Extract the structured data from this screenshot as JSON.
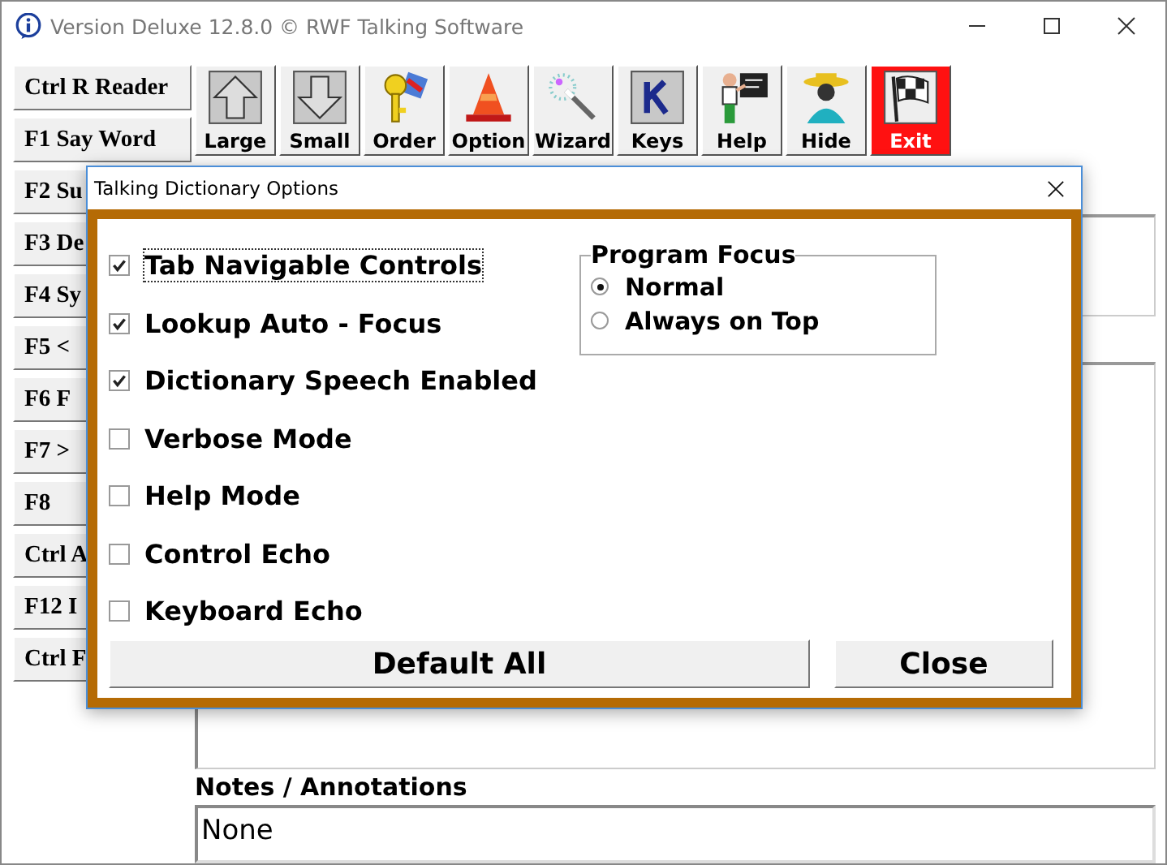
{
  "window": {
    "title": "Version Deluxe 12.8.0 © RWF Talking Software"
  },
  "sidebar": {
    "buttons": [
      "Ctrl R Reader",
      "F1 Say Word",
      "F2 Su",
      "F3 De",
      "F4 Sy",
      "F5 <",
      "F6 F",
      "F7 >",
      "F8",
      "Ctrl A",
      "F12 I",
      "Ctrl F"
    ]
  },
  "toolbar": [
    {
      "label": "Large",
      "kind": "normal"
    },
    {
      "label": "Small",
      "kind": "normal"
    },
    {
      "label": "Order",
      "kind": "normal"
    },
    {
      "label": "Option",
      "kind": "normal"
    },
    {
      "label": "Wizard",
      "kind": "normal"
    },
    {
      "label": "Keys",
      "kind": "normal"
    },
    {
      "label": "Help",
      "kind": "normal"
    },
    {
      "label": "Hide",
      "kind": "normal"
    },
    {
      "label": "Exit",
      "kind": "exit"
    }
  ],
  "notes": {
    "label": "Notes / Annotations",
    "value": "None"
  },
  "dialog": {
    "title": "Talking Dictionary Options",
    "options": [
      {
        "label": "Tab Navigable Controls",
        "checked": true,
        "focused": true
      },
      {
        "label": "Lookup Auto - Focus",
        "checked": true,
        "focused": false
      },
      {
        "label": "Dictionary Speech Enabled",
        "checked": true,
        "focused": false
      },
      {
        "label": "Verbose Mode",
        "checked": false,
        "focused": false
      },
      {
        "label": "Help Mode",
        "checked": false,
        "focused": false
      },
      {
        "label": "Control Echo",
        "checked": false,
        "focused": false
      },
      {
        "label": "Keyboard Echo",
        "checked": false,
        "focused": false
      }
    ],
    "program_focus": {
      "title": "Program Focus",
      "choices": [
        {
          "label": "Normal",
          "selected": true
        },
        {
          "label": "Always on Top",
          "selected": false
        }
      ]
    },
    "buttons": [
      {
        "label": "Default All"
      },
      {
        "label": "Close"
      }
    ]
  }
}
